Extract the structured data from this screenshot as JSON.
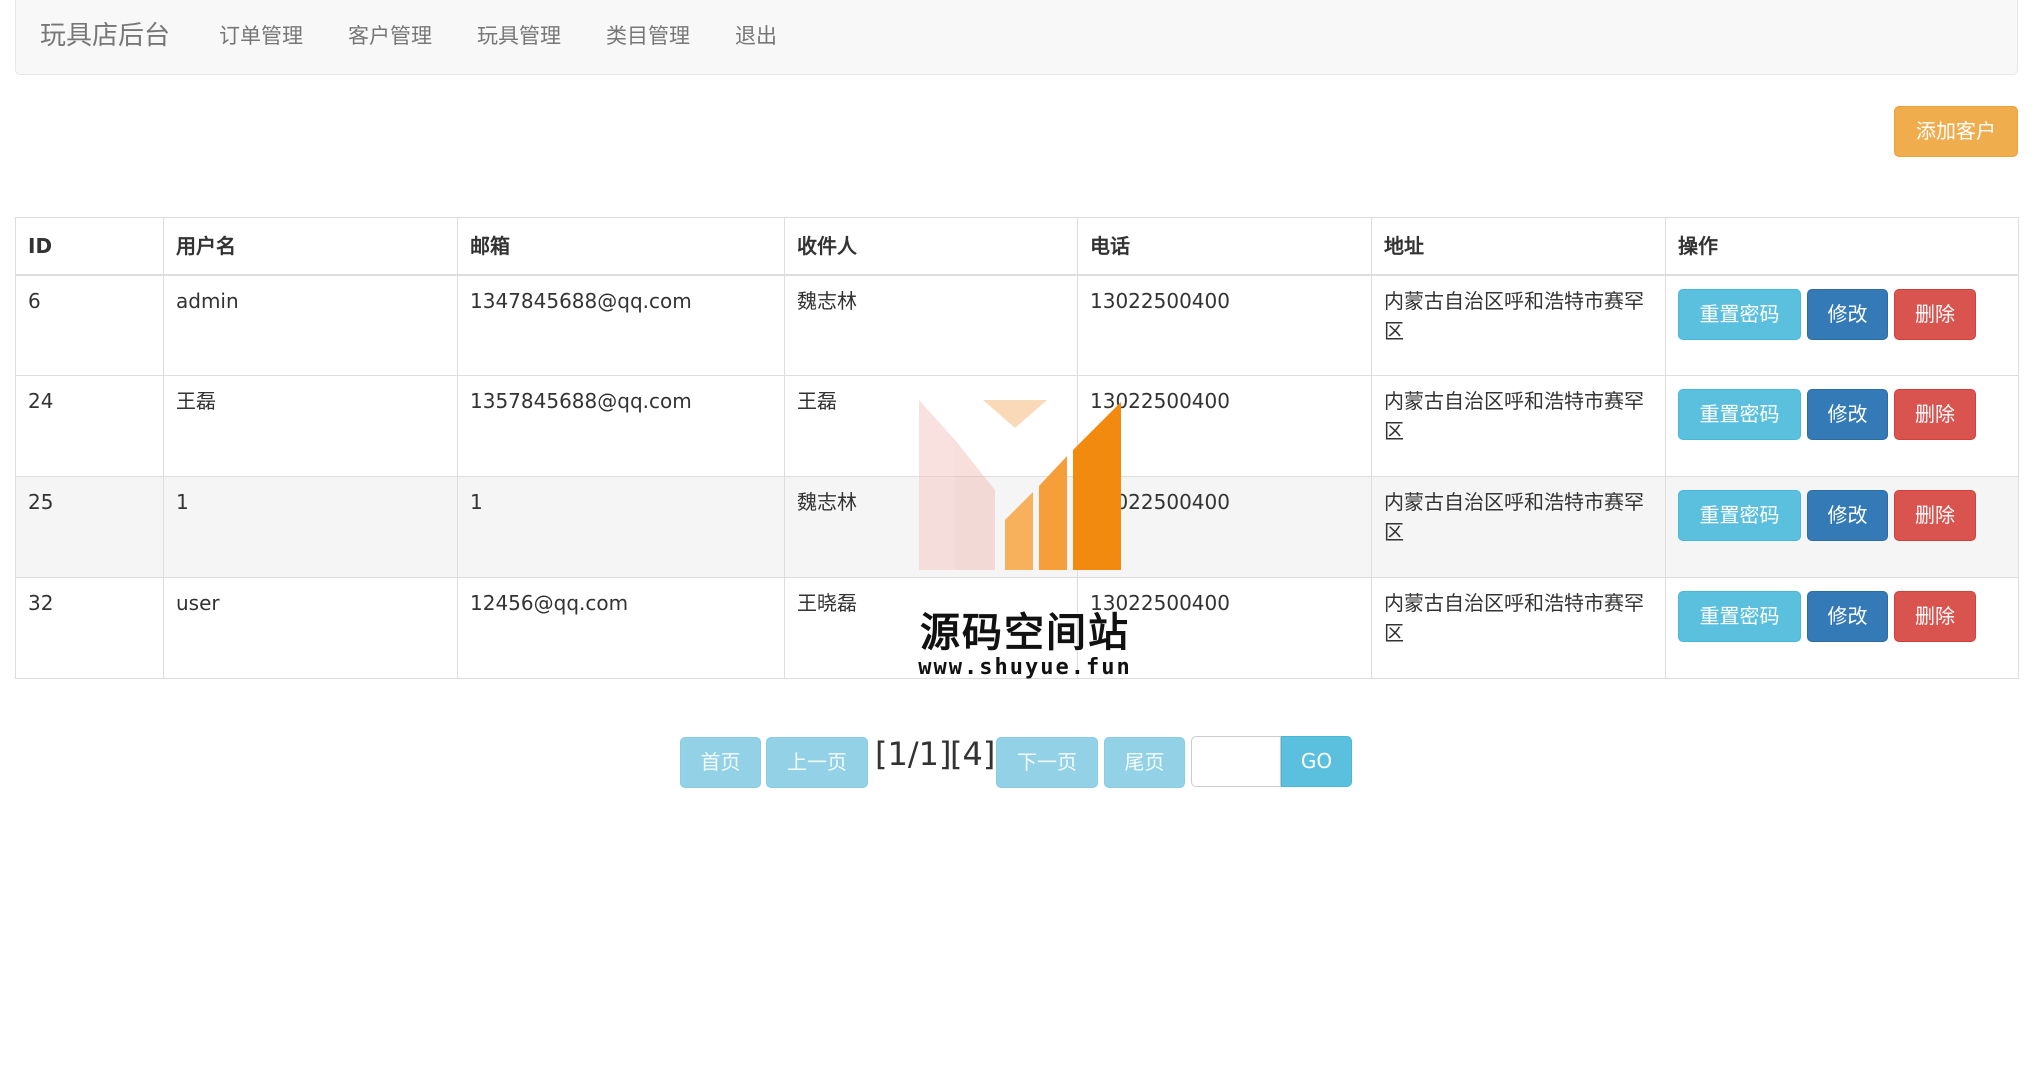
{
  "navbar": {
    "brand": "玩具店后台",
    "links": [
      "订单管理",
      "客户管理",
      "玩具管理",
      "类目管理",
      "退出"
    ]
  },
  "add_button_label": "添加客户",
  "table": {
    "headers": [
      "ID",
      "用户名",
      "邮箱",
      "收件人",
      "电话",
      "地址",
      "操作"
    ],
    "rows": [
      {
        "id": "6",
        "username": "admin",
        "email": "1347845688@qq.com",
        "recipient": "魏志林",
        "phone": "13022500400",
        "address": "内蒙古自治区呼和浩特市赛罕区"
      },
      {
        "id": "24",
        "username": "王磊",
        "email": "1357845688@qq.com",
        "recipient": "王磊",
        "phone": "13022500400",
        "address": "内蒙古自治区呼和浩特市赛罕区"
      },
      {
        "id": "25",
        "username": "1",
        "email": "1",
        "recipient": "魏志林",
        "phone": "13022500400",
        "address": "内蒙古自治区呼和浩特市赛罕区"
      },
      {
        "id": "32",
        "username": "user",
        "email": "12456@qq.com",
        "recipient": "王晓磊",
        "phone": "13022500400",
        "address": "内蒙古自治区呼和浩特市赛罕区"
      }
    ],
    "row_actions": {
      "reset": "重置密码",
      "edit": "修改",
      "delete": "删除"
    }
  },
  "pagination": {
    "first": "首页",
    "prev": "上一页",
    "page_indicator": "[1/1]",
    "total_indicator": "[4]",
    "next": "下一页",
    "last": "尾页",
    "go": "GO"
  },
  "watermark": {
    "title": "源码空间站",
    "url": "www.shuyue.fun"
  },
  "colors": {
    "warning": "#f0ad4e",
    "info": "#5bc0de",
    "primary": "#337ab7",
    "danger": "#d9534f"
  }
}
